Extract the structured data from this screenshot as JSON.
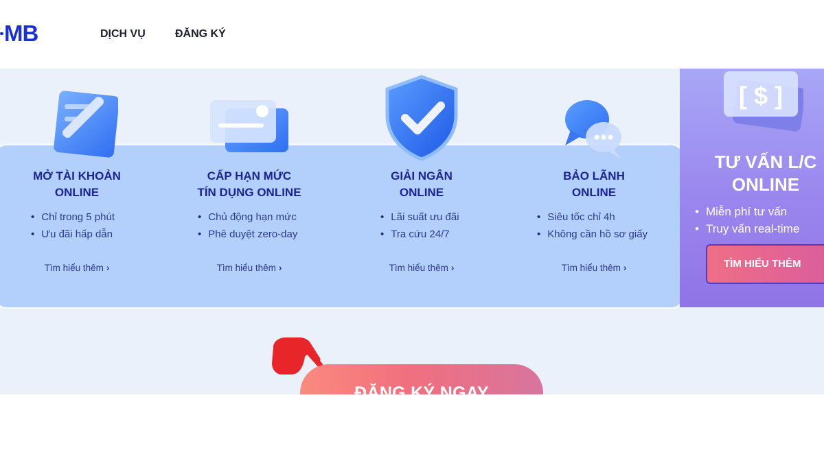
{
  "header": {
    "logo": "MB",
    "nav": [
      "DỊCH VỤ",
      "ĐĂNG KÝ"
    ]
  },
  "cards": [
    {
      "icon": "document-pen-icon",
      "title_line1": "MỞ TÀI KHOẢN",
      "title_line2": "ONLINE",
      "bullets": [
        "Chỉ trong 5 phút",
        "Ưu đãi hấp dẫn"
      ],
      "link": "Tìm hiểu thêm"
    },
    {
      "icon": "credit-card-icon",
      "title_line1": "CẤP HẠN MỨC",
      "title_line2": "TÍN DỤNG ONLINE",
      "bullets": [
        "Chủ động hạn mức",
        "Phê duyệt zero-day"
      ],
      "link": "Tìm hiểu thêm"
    },
    {
      "icon": "shield-check-icon",
      "title_line1": "GIẢI NGÂN",
      "title_line2": "ONLINE",
      "bullets": [
        "Lãi suất ưu đãi",
        "Tra cứu 24/7"
      ],
      "link": "Tìm hiểu thêm"
    },
    {
      "icon": "chat-bubbles-icon",
      "title_line1": "BẢO LÃNH",
      "title_line2": "ONLINE",
      "bullets": [
        "Siêu tốc chỉ 4h",
        "Không cần hồ sơ giấy"
      ],
      "link": "Tìm hiểu thêm"
    }
  ],
  "lc_card": {
    "icon": "dollar-bill-icon",
    "title_line1": "TƯ VẤN L/C",
    "title_line2": "ONLINE",
    "bullets": [
      "Miễn phí tư vấn",
      "Truy vấn real-time"
    ],
    "button": "TÌM HIỂU THÊM"
  },
  "cta": {
    "label": "ĐĂNG KÝ NGAY",
    "pointer_icon": "pointing-hand-icon"
  },
  "colors": {
    "brand": "#1a2fd6",
    "panel": "#b3cffb",
    "title": "#1a2494",
    "lc_bg": "#9a86ee",
    "cta": "#f16f7e",
    "pointer": "#e8262a"
  }
}
